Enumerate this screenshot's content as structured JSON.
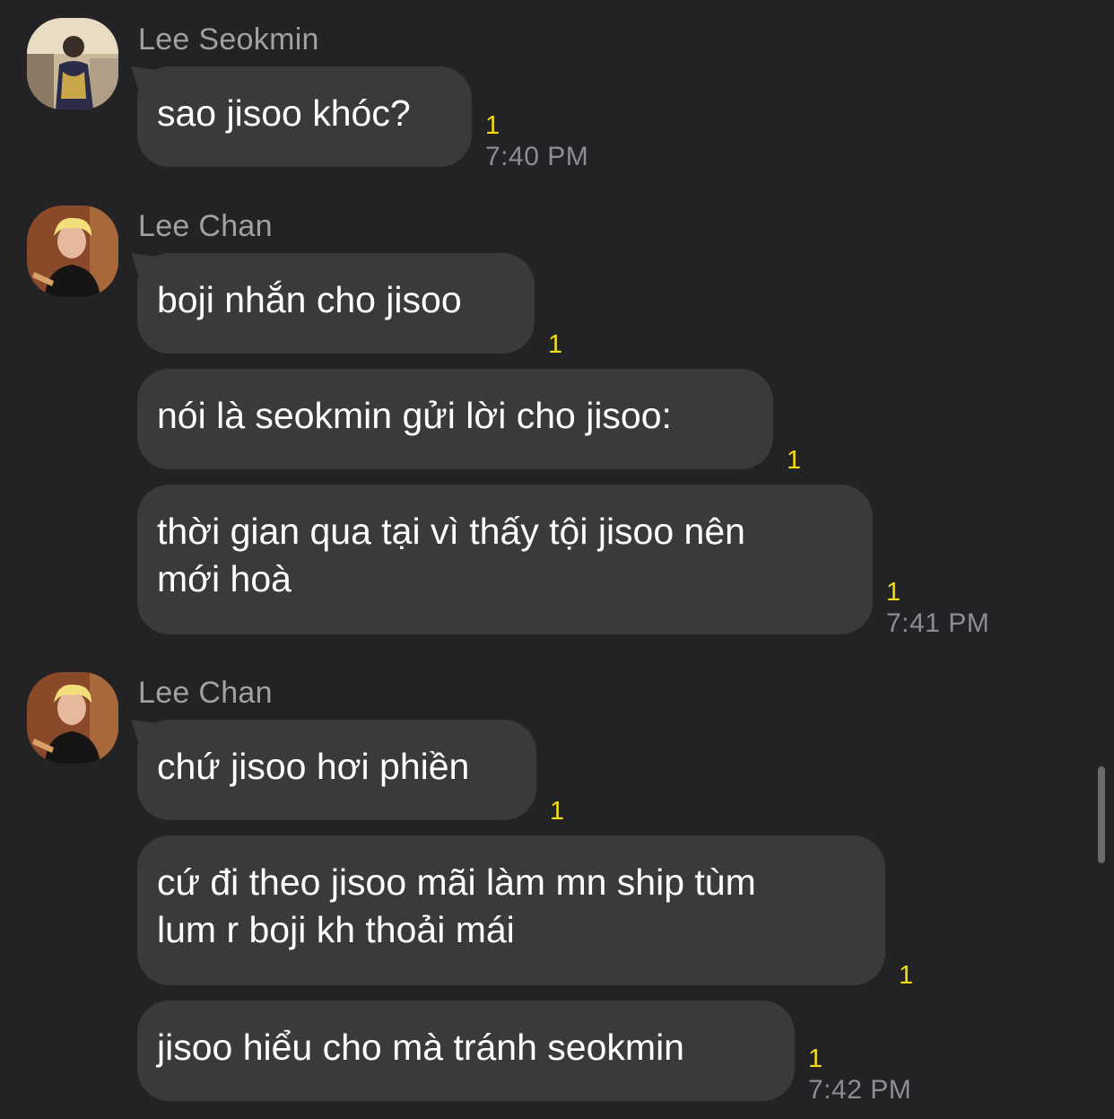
{
  "colors": {
    "background": "#232325",
    "bubble": "#3a3a3d",
    "unread": "#f3dc14",
    "sender_name": "#a1a1a4",
    "timestamp": "#8e8e92"
  },
  "groups": [
    {
      "sender": "Lee Seokmin",
      "avatar": "avatar-photo-icon",
      "messages": [
        {
          "text": "sao jisoo khóc?",
          "unread": "1",
          "time": "7:40 PM"
        }
      ]
    },
    {
      "sender": "Lee Chan",
      "avatar": "avatar-photo-icon",
      "messages": [
        {
          "text": "boji nhắn cho jisoo",
          "unread": "1"
        },
        {
          "text": "nói là seokmin gửi lời cho jisoo:",
          "unread": "1"
        },
        {
          "lines": [
            "thời gian qua tại vì thấy tội jisoo nên",
            "mới hoà"
          ],
          "unread": "1",
          "time": "7:41 PM"
        }
      ]
    },
    {
      "sender": "Lee Chan",
      "avatar": "avatar-photo-icon",
      "messages": [
        {
          "text": "chứ jisoo hơi phiền",
          "unread": "1"
        },
        {
          "lines": [
            "cứ đi theo jisoo mãi làm mn ship tùm",
            "lum r boji kh thoải mái"
          ],
          "unread": "1"
        },
        {
          "text": "jisoo hiểu cho mà tránh seokmin",
          "unread": "1",
          "time": "7:42 PM"
        }
      ]
    }
  ]
}
